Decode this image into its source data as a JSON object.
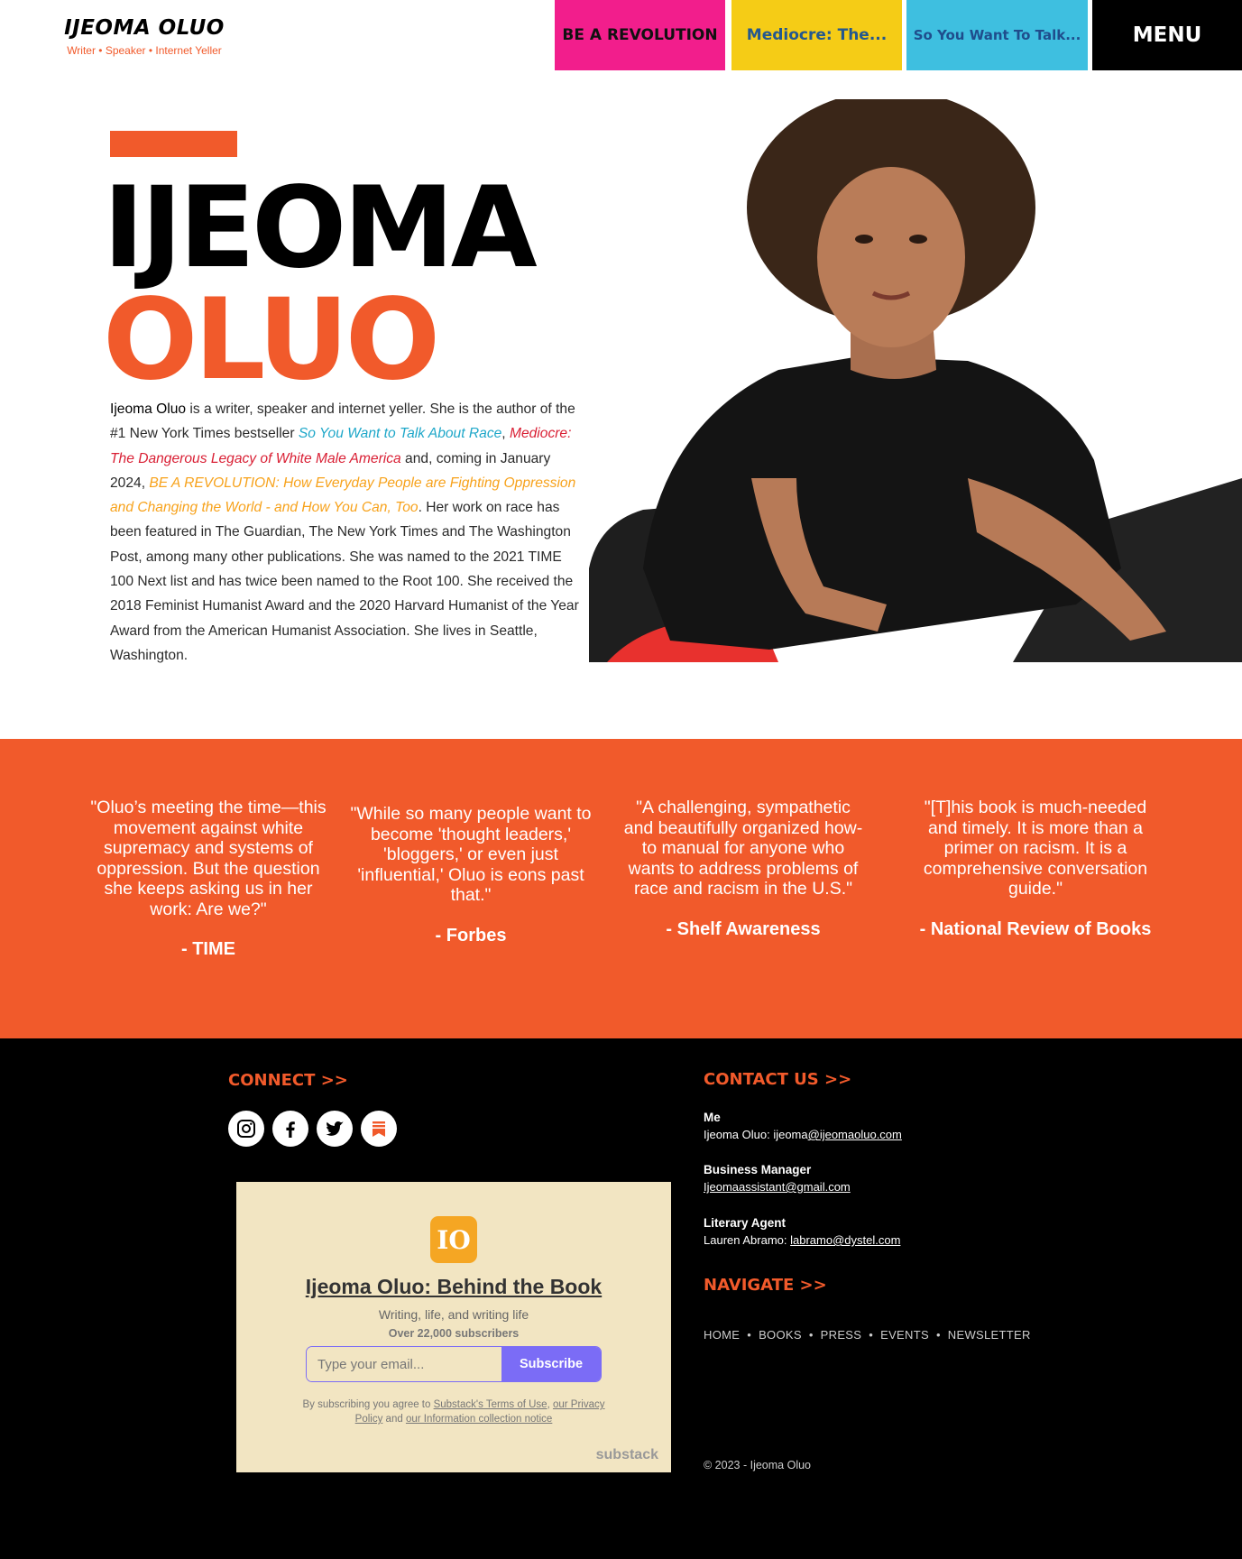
{
  "header": {
    "brand_name": "IJEOMA OLUO",
    "brand_tagline": "Writer • Speaker • Internet Yeller",
    "tabs": [
      {
        "label": "BE A REVOLUTION"
      },
      {
        "label": "Mediocre: The..."
      },
      {
        "label": "So You Want To Talk..."
      },
      {
        "label": "MENU"
      }
    ]
  },
  "hero": {
    "first_name": "IJEOMA",
    "last_name": "OLUO",
    "bio": {
      "name": "Ijeoma Oluo",
      "p1": " is a writer, speaker and internet yeller. She is the author of the #1 New York Times bestseller ",
      "book1": "So You Want to Talk About Race",
      "p2": ", ",
      "book2": "Mediocre: The Dangerous Legacy of White Male America",
      "p3": " and, coming in January 2024, ",
      "book3": "BE A REVOLUTION: How Everyday People are Fighting Oppression and Changing the World - and How You Can, Too",
      "p4": ". Her work on race has been featured in The Guardian, The New York Times and The Washington Post, among many other publications. She was named to the 2021 TIME 100 Next list and has twice been named to the Root 100. She received the 2018 Feminist Humanist Award and the 2020 Harvard Humanist of the Year Award from the American Humanist Association. She lives in Seattle, Washington."
    }
  },
  "quotes": [
    {
      "text": "\"Oluo’s meeting the time—this movement against white supremacy and systems of oppression. But the question she keeps asking us in her work: Are we?\"",
      "source": "- TIME"
    },
    {
      "text": "\"While so many people want to become 'thought leaders,' 'bloggers,' or even just 'influential,' Oluo is eons past that.\"",
      "source": "- Forbes"
    },
    {
      "text": "\"A challenging, sympathetic and beautifully organized how-to manual for anyone who wants to address problems of race and racism in the U.S.\"",
      "source": "- Shelf Awareness"
    },
    {
      "text": "\"[T]his book is much-needed and timely. It is more than a primer on racism. It is a comprehensive conversation guide.\"",
      "source": "- National Review of Books"
    }
  ],
  "footer": {
    "connect_heading": "CONNECT >>",
    "social": [
      "instagram-icon",
      "facebook-icon",
      "twitter-icon",
      "substack-icon"
    ],
    "substack": {
      "logo_text": "IO",
      "title": "Ijeoma Oluo: Behind the Book",
      "subtitle": "Writing, life, and writing life",
      "subscribers": "Over 22,000 subscribers",
      "email_placeholder": "Type your email...",
      "button": "Subscribe",
      "terms_prefix": "By subscribing you agree to ",
      "terms_link": "Substack's Terms of Use",
      "terms_mid": ", ",
      "privacy_link": "our Privacy Policy",
      "terms_and": " and ",
      "info_link": "our Information collection notice",
      "brand": "substack"
    },
    "contact_heading": "CONTACT US >>",
    "contacts": [
      {
        "label": "Me",
        "prefix": "Ijeoma Oluo: ijeoma",
        "link": "@ijeomaoluo.com"
      },
      {
        "label": "Business Manager",
        "prefix": "",
        "link": "Ijeomaassistant@gmail.com"
      },
      {
        "label": "Literary Agent",
        "prefix": "Lauren Abramo: ",
        "link": "labramo@dystel.com"
      }
    ],
    "navigate_heading": "NAVIGATE >>",
    "nav": [
      "HOME",
      "BOOKS",
      "PRESS",
      "EVENTS",
      "NEWSLETTER"
    ],
    "nav_separator": "•",
    "copyright": "© 2023 - Ijeoma Oluo"
  },
  "colors": {
    "accent": "#f15a2b",
    "pink": "#f21e8c",
    "yellow": "#f5cc16",
    "cyan": "#3ebfe0",
    "substack_purple": "#7b6cf6"
  }
}
